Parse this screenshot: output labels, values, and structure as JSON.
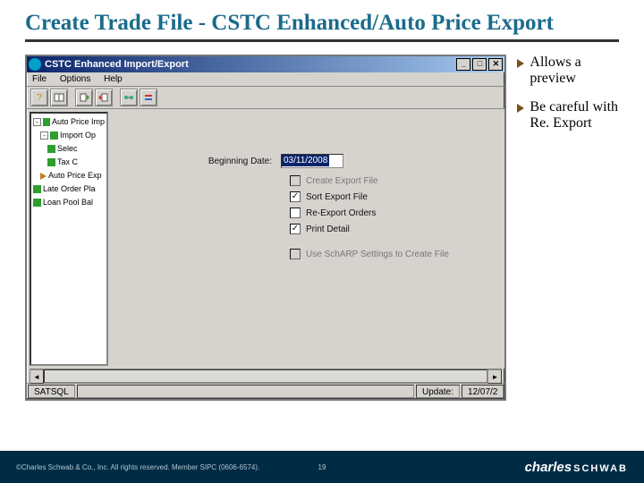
{
  "slide": {
    "title": "Create Trade File - CSTC Enhanced/Auto Price Export",
    "bullets": [
      "Allows a preview",
      "Be careful with Re. Export"
    ]
  },
  "window": {
    "title": "CSTC Enhanced Import/Export",
    "controls": {
      "min": "_",
      "max": "□",
      "close": "✕"
    },
    "menu": [
      "File",
      "Options",
      "Help"
    ],
    "tree": [
      {
        "expand": "-",
        "icon": "green",
        "label": "Auto Price Imp"
      },
      {
        "expand": "-",
        "icon": "green",
        "label": "Import Op",
        "indent": 1
      },
      {
        "expand": "",
        "icon": "green",
        "label": "Selec",
        "indent": 2
      },
      {
        "expand": "",
        "icon": "green",
        "label": "Tax C",
        "indent": 2
      },
      {
        "expand": "",
        "icon": "arrow",
        "label": "Auto Price Exp",
        "indent": 1
      },
      {
        "expand": "",
        "icon": "green",
        "label": "Late Order Pla"
      },
      {
        "expand": "",
        "icon": "green",
        "label": "Loan Pool Bal"
      }
    ],
    "form": {
      "date_label": "Beginning Date:",
      "date_value": "03/11/2008",
      "checks": [
        {
          "label": "Create Export File",
          "checked": false,
          "enabled": false
        },
        {
          "label": "Sort Export File",
          "checked": true,
          "enabled": true
        },
        {
          "label": "Re-Export Orders",
          "checked": false,
          "enabled": true
        },
        {
          "label": "Print Detail",
          "checked": true,
          "enabled": true
        },
        {
          "label": "Use SchARP Settings to Create File",
          "checked": false,
          "enabled": false
        }
      ]
    },
    "status": {
      "left": "SATSQL",
      "mid": "",
      "update_label": "Update:",
      "update_val": "12/07/2"
    }
  },
  "footer": {
    "copyright": "©Charles Schwab & Co., Inc. All rights reserved. Member SIPC (0606-6574).",
    "page": "19",
    "logo1": "charles",
    "logo2": "SCHWAB"
  }
}
